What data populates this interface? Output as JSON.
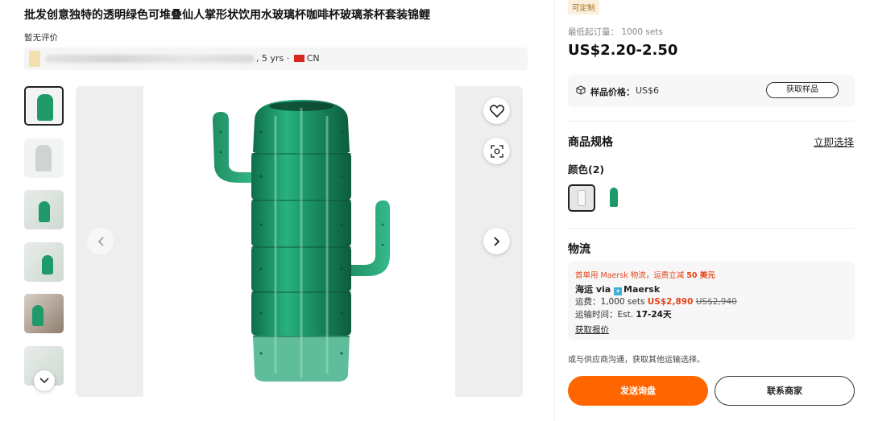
{
  "product": {
    "title": "批发创意独特的透明绿色可堆叠仙人掌形状饮用水玻璃杯咖啡杯玻璃茶杯套装锦鲤",
    "review_text": "暂无评价",
    "supplier_meta": ", 5 yrs · ",
    "country": "CN"
  },
  "gallery": {
    "thumbnail_count": 6,
    "icons": {
      "favorite": "heart-icon",
      "image_search": "scan-icon",
      "prev": "chevron-left-icon",
      "next": "chevron-right-icon",
      "more_thumbs": "chevron-down-icon"
    },
    "product_color": "#1e9a68"
  },
  "purchase": {
    "custom_tag": "可定制",
    "moq": "最低起订量： 1000 sets",
    "price": "US$2.20-2.50",
    "sample_label": "样品价格：",
    "sample_value": "US$6",
    "sample_button": "获取样品",
    "spec_title": "商品规格",
    "spec_select": "立即选择",
    "color_label": "颜色(2)",
    "logistics_title": "物流",
    "promo_prefix": "首单用 Maersk 物流，运费立减 ",
    "promo_bold": "50 美元",
    "carrier_prefix": "海运 via ",
    "carrier_name": "Maersk",
    "fee_label": "运费：1,000 sets ",
    "fee_price": "US$2,890",
    "fee_original": "US$2,940",
    "time_label": "运输时间：Est. ",
    "time_value": "17-24天",
    "quote_link": "获取报价",
    "other_options": "或与供应商沟通，获取其他运输选择。",
    "inquiry_button": "发送询盘",
    "contact_button": "联系商家"
  },
  "colors": {
    "accent": "#ff6600",
    "discount": "#e5451b"
  }
}
